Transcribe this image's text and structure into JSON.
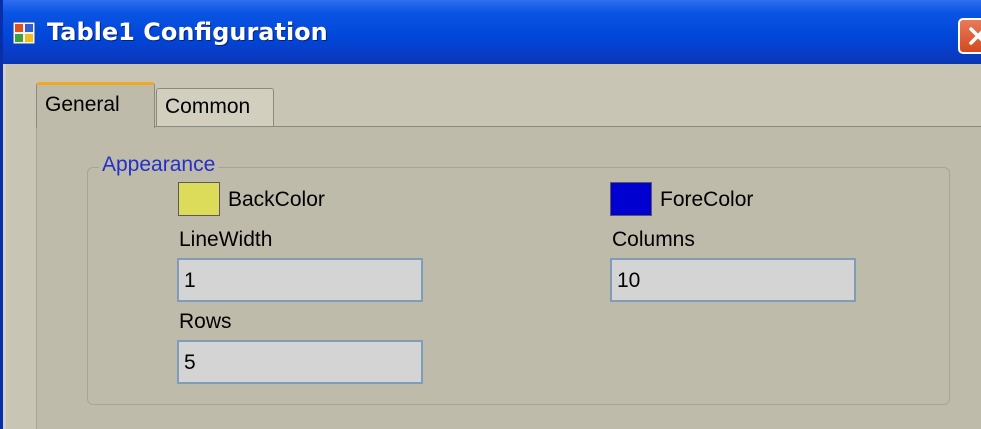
{
  "window": {
    "title": "Table1 Configuration"
  },
  "tabs": [
    {
      "label": "General",
      "active": true
    },
    {
      "label": "Common",
      "active": false
    }
  ],
  "appearance": {
    "group_title": "Appearance",
    "back_color": {
      "label": "BackColor",
      "color": "#dcdc5a"
    },
    "fore_color": {
      "label": "ForeColor",
      "color": "#0000d0"
    },
    "line_width": {
      "label": "LineWidth",
      "value": "1"
    },
    "columns": {
      "label": "Columns",
      "value": "10"
    },
    "rows": {
      "label": "Rows",
      "value": "5"
    }
  },
  "icons": {
    "app": "table-icon",
    "close": "close-icon"
  }
}
